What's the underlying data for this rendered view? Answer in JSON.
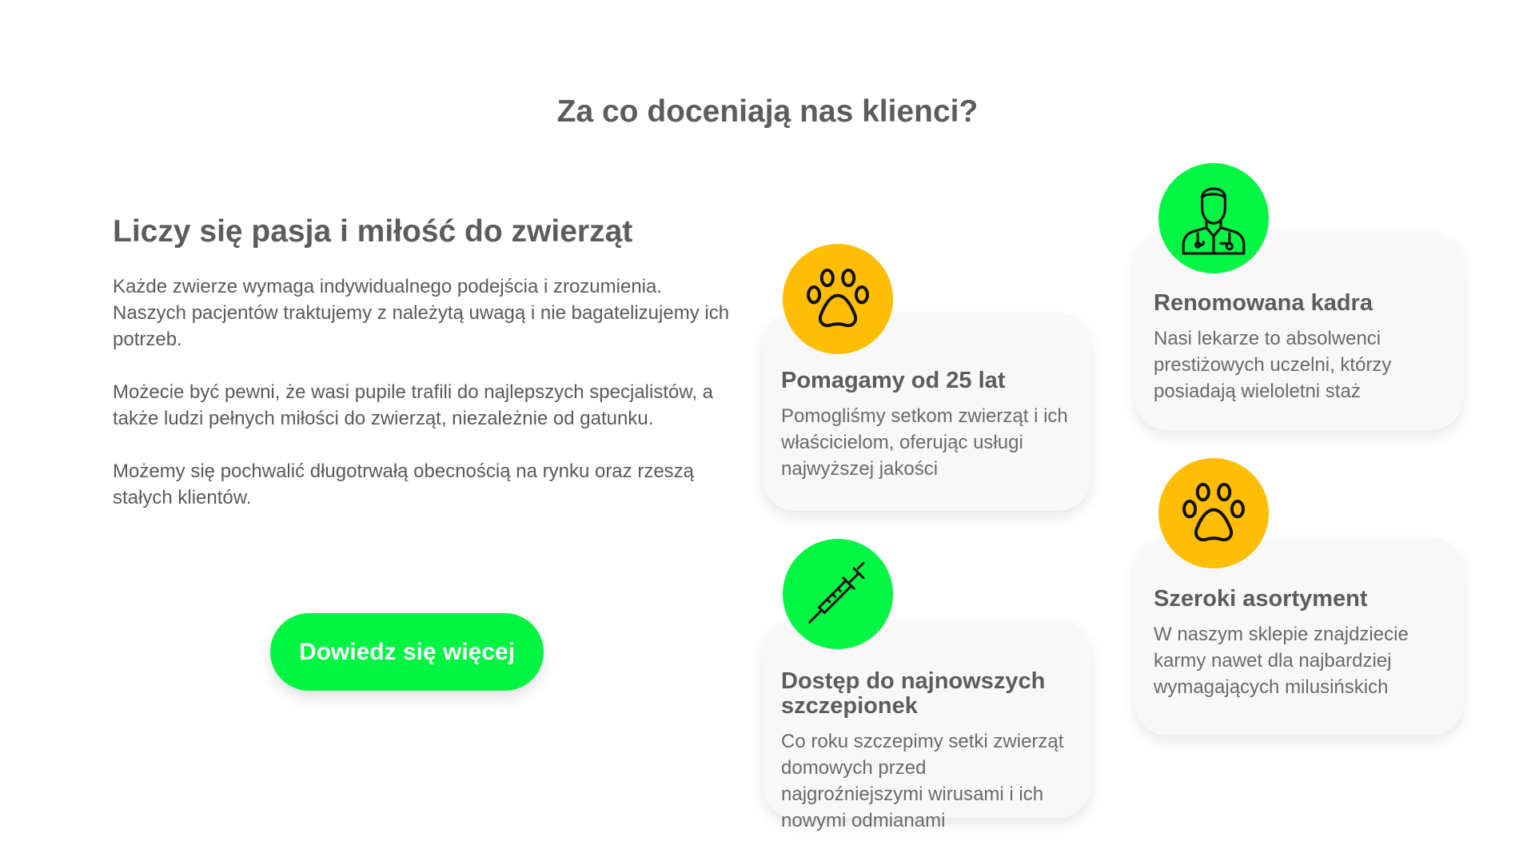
{
  "heading": "Za co doceniają nas klienci?",
  "intro": {
    "title": "Liczy się pasja i miłość do zwierząt",
    "paragraphs": [
      "Każde zwierze wymaga indywidualnego podejścia i zrozumienia. Naszych pacjentów traktujemy z należytą uwagą i nie bagatelizujemy ich potrzeb.",
      "Możecie być pewni, że wasi pupile trafili do najlepszych specjalistów, a także ludzi pełnych miłości do zwierząt, niezależnie od gatunku.",
      "Możemy się pochwalić długotrwałą obecnością na rynku oraz rzeszą stałych klientów."
    ],
    "button": "Dowiedz się więcej"
  },
  "features": [
    {
      "title": "Pomagamy od 25 lat",
      "desc": "Pomogliśmy setkom zwierząt i ich właścicielom, oferując usługi najwyższej jakości",
      "icon": "paw-icon",
      "color": "#ffbd03"
    },
    {
      "title": "Renomowana kadra",
      "desc": "Nasi lekarze to absolwenci prestiżowych uczelni, którzy posiadają wieloletni staż",
      "icon": "doctor-icon",
      "color": "#05f545"
    },
    {
      "title": "Dostęp do najnowszych szczepionek",
      "desc": "Co roku szczepimy setki zwierząt domowych przed najgroźniejszymi wirusami i ich nowymi odmianami",
      "icon": "syringe-icon",
      "color": "#05f545"
    },
    {
      "title": "Szeroki asortyment",
      "desc": "W naszym sklepie znajdziecie karmy nawet dla najbardziej wymagających milusińskich",
      "icon": "paw-icon",
      "color": "#ffbd03"
    }
  ],
  "colors": {
    "accent_green": "#05f545",
    "accent_yellow": "#ffbd03",
    "text": "#5a5a5a"
  }
}
